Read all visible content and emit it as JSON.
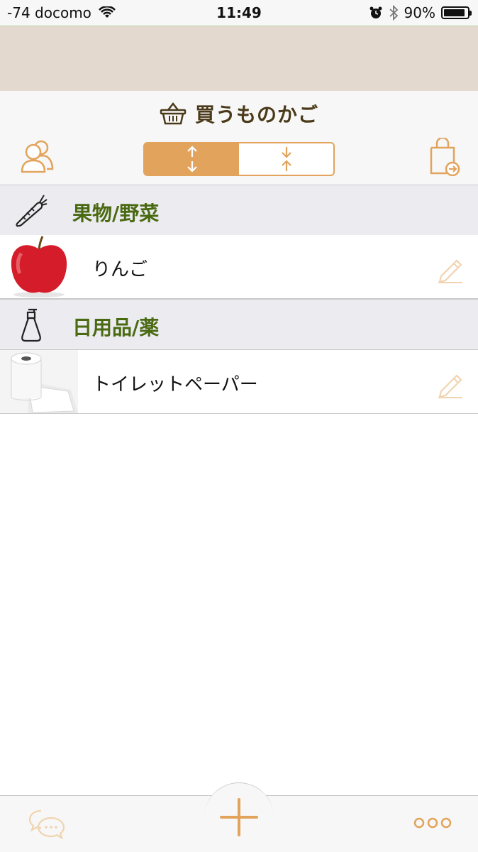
{
  "status_bar": {
    "carrier": "-74 docomo",
    "time": "11:49",
    "battery_percent": "90%",
    "battery_level": 0.9
  },
  "header": {
    "title": "買うものかご",
    "title_icon": "basket-icon",
    "left_button_icon": "members-icon",
    "right_button_icon": "shopping-bag-exit-icon",
    "segments": [
      {
        "icon": "expand-arrows-icon",
        "selected": true
      },
      {
        "icon": "collapse-arrows-icon",
        "selected": false
      }
    ]
  },
  "sections": [
    {
      "title": "果物/野菜",
      "icon": "carrot-icon",
      "items": [
        {
          "name": "りんご",
          "thumbnail": "apple-photo",
          "action_icon": "pencil-icon"
        }
      ]
    },
    {
      "title": "日用品/薬",
      "icon": "pump-bottle-icon",
      "items": [
        {
          "name": "トイレットペーパー",
          "thumbnail": "toilet-paper-photo",
          "action_icon": "pencil-icon"
        }
      ]
    }
  ],
  "tab_bar": {
    "left_icon": "chat-bubbles-icon",
    "center_icon": "plus-icon",
    "right_icon": "more-dots-icon"
  },
  "colors": {
    "accent": "#e2a35c",
    "section_title": "#4a6a12",
    "title": "#4a3a1a",
    "banner": "#e4d9cf"
  }
}
